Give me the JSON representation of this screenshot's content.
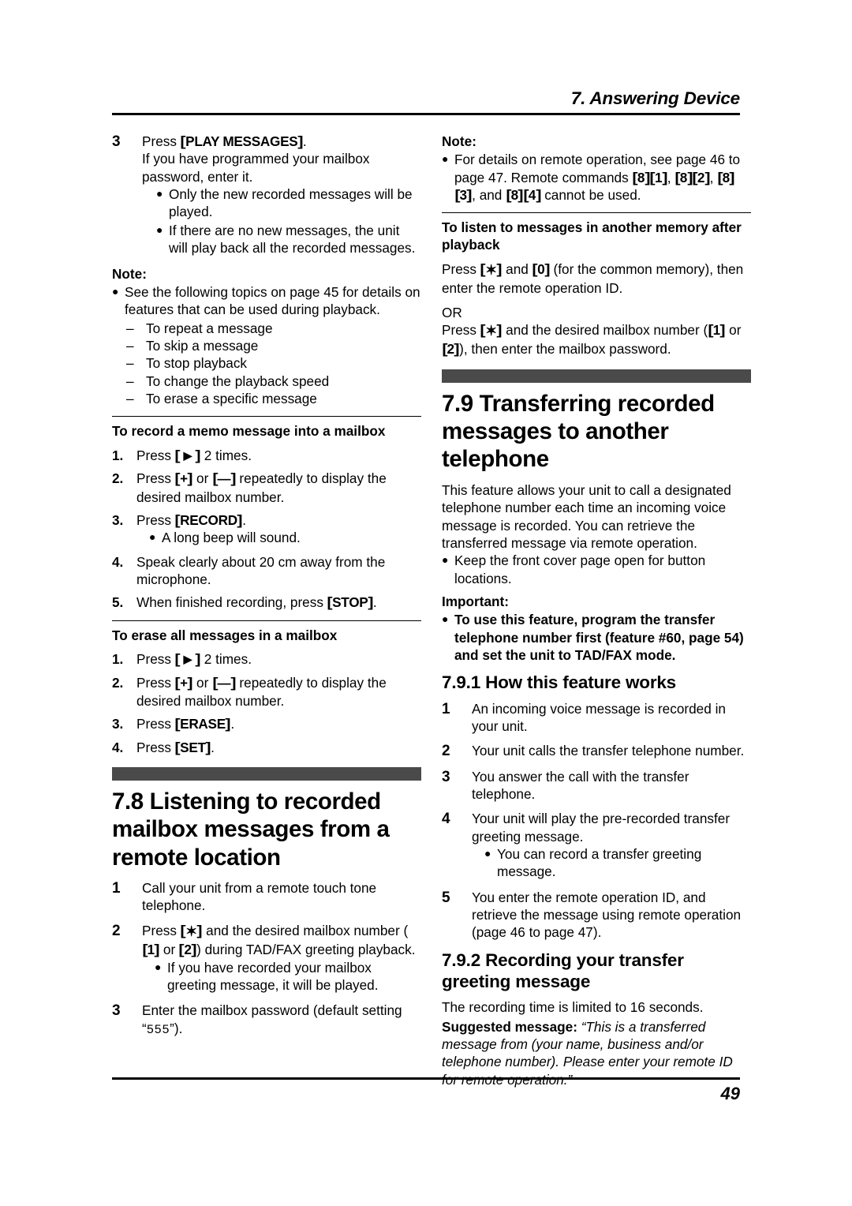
{
  "header": {
    "chapter_title": "7. Answering Device"
  },
  "footer": {
    "page_number": "49"
  },
  "left_column": {
    "step3": {
      "num": "3",
      "press_label": "Press ",
      "key_play": "PLAY MESSAGES",
      "after_key": ".",
      "line2": "If you have programmed your mailbox password, enter it.",
      "bullets": [
        "Only the new recorded messages will be played.",
        "If there are no new messages, the unit will play back all the recorded messages."
      ]
    },
    "note": {
      "label": "Note:",
      "bullet": "See the following topics on page 45 for details on features that can be used during playback.",
      "dashes": [
        "To repeat a message",
        "To skip a message",
        "To stop playback",
        "To change the playback speed",
        "To erase a specific message"
      ]
    },
    "memo_section": {
      "heading": "To record a memo message into a mailbox",
      "steps": [
        {
          "num": "1.",
          "pre": "Press ",
          "key": "▶",
          "post": " 2 times."
        },
        {
          "num": "2.",
          "pre": "Press ",
          "key_plus": "+",
          "mid": " or ",
          "key_minus": "—",
          "post": " repeatedly to display the desired mailbox number."
        },
        {
          "num": "3.",
          "pre": "Press ",
          "key": "RECORD",
          "post": "."
        },
        {
          "num": "4.",
          "text": "Speak clearly about 20 cm away from the microphone."
        },
        {
          "num": "5.",
          "pre": "When finished recording, press ",
          "key": "STOP",
          "post": "."
        }
      ],
      "step3_bullet": "A long beep will sound."
    },
    "erase_section": {
      "heading": "To erase all messages in a mailbox",
      "steps": [
        {
          "num": "1.",
          "pre": "Press ",
          "key": "▶",
          "post": " 2 times."
        },
        {
          "num": "2.",
          "pre": "Press ",
          "key_plus": "+",
          "mid": " or ",
          "key_minus": "—",
          "post": " repeatedly to display the desired mailbox number."
        },
        {
          "num": "3.",
          "pre": "Press ",
          "key": "ERASE",
          "post": "."
        },
        {
          "num": "4.",
          "pre": "Press ",
          "key": "SET",
          "post": "."
        }
      ]
    },
    "section_78": {
      "heading": "7.8 Listening to recorded mailbox messages from a remote location",
      "step1": {
        "num": "1",
        "text": "Call your unit from a remote touch tone telephone."
      },
      "step2": {
        "num": "2",
        "pre": "Press ",
        "key_star": "✶",
        "mid1": " and the desired mailbox number (",
        "key_1": "1",
        "mid2": " or ",
        "key_2": "2",
        "post": ") during TAD/FAX greeting playback.",
        "bullet": "If you have recorded your mailbox greeting message, it will be played."
      },
      "step3": {
        "num": "3",
        "pre": "Enter the mailbox password (default setting “",
        "mono": "555",
        "post": "”)."
      }
    }
  },
  "right_column": {
    "note": {
      "label": "Note:",
      "bullet_pre": "For details on remote operation, see page 46 to page 47. Remote commands ",
      "cmd1_a": "8",
      "cmd1_b": "1",
      "sep1": ", ",
      "cmd2_a": "8",
      "cmd2_b": "2",
      "sep2": ", ",
      "cmd3_a": "8",
      "cmd3_b": "3",
      "sep3": ", and ",
      "cmd4_a": "8",
      "cmd4_b": "4",
      "bullet_post": " cannot be used."
    },
    "listen_section": {
      "heading": "To listen to messages in another memory after playback",
      "para1_pre": "Press ",
      "para1_star": "✶",
      "para1_mid": " and ",
      "para1_key0": "0",
      "para1_post": " (for the common memory), then enter the remote operation ID.",
      "or_text": "OR",
      "para2_pre": "Press ",
      "para2_star": "✶",
      "para2_mid1": " and the desired mailbox number (",
      "para2_key1": "1",
      "para2_mid2": " or ",
      "para2_key2": "2",
      "para2_post": "), then enter the mailbox password."
    },
    "section_79": {
      "heading": "7.9 Transferring recorded messages to another telephone",
      "intro": "This feature allows your unit to call a designated telephone number each time an incoming voice message is recorded. You can retrieve the transferred message via remote operation.",
      "bullet": "Keep the front cover page open for button locations.",
      "important_label": "Important:",
      "important_bullet": "To use this feature, program the transfer telephone number first (feature #60, page 54) and set the unit to TAD/FAX mode."
    },
    "section_791": {
      "heading": "7.9.1 How this feature works",
      "steps": [
        {
          "num": "1",
          "text": "An incoming voice message is recorded in your unit."
        },
        {
          "num": "2",
          "text": "Your unit calls the transfer telephone number."
        },
        {
          "num": "3",
          "text": "You answer the call with the transfer telephone."
        },
        {
          "num": "4",
          "text": "Your unit will play the pre-recorded transfer greeting message."
        },
        {
          "num": "5",
          "text": "You enter the remote operation ID, and retrieve the message using remote operation (page 46 to page 47)."
        }
      ],
      "step4_bullet": "You can record a transfer greeting message."
    },
    "section_792": {
      "heading": "7.9.2 Recording your transfer greeting message",
      "intro": "The recording time is limited to 16 seconds.",
      "suggested_label": "Suggested message:",
      "suggested_text": " “This is a transferred message from (your name, business and/or telephone number). Please enter your remote ID for remote operation.”"
    }
  }
}
